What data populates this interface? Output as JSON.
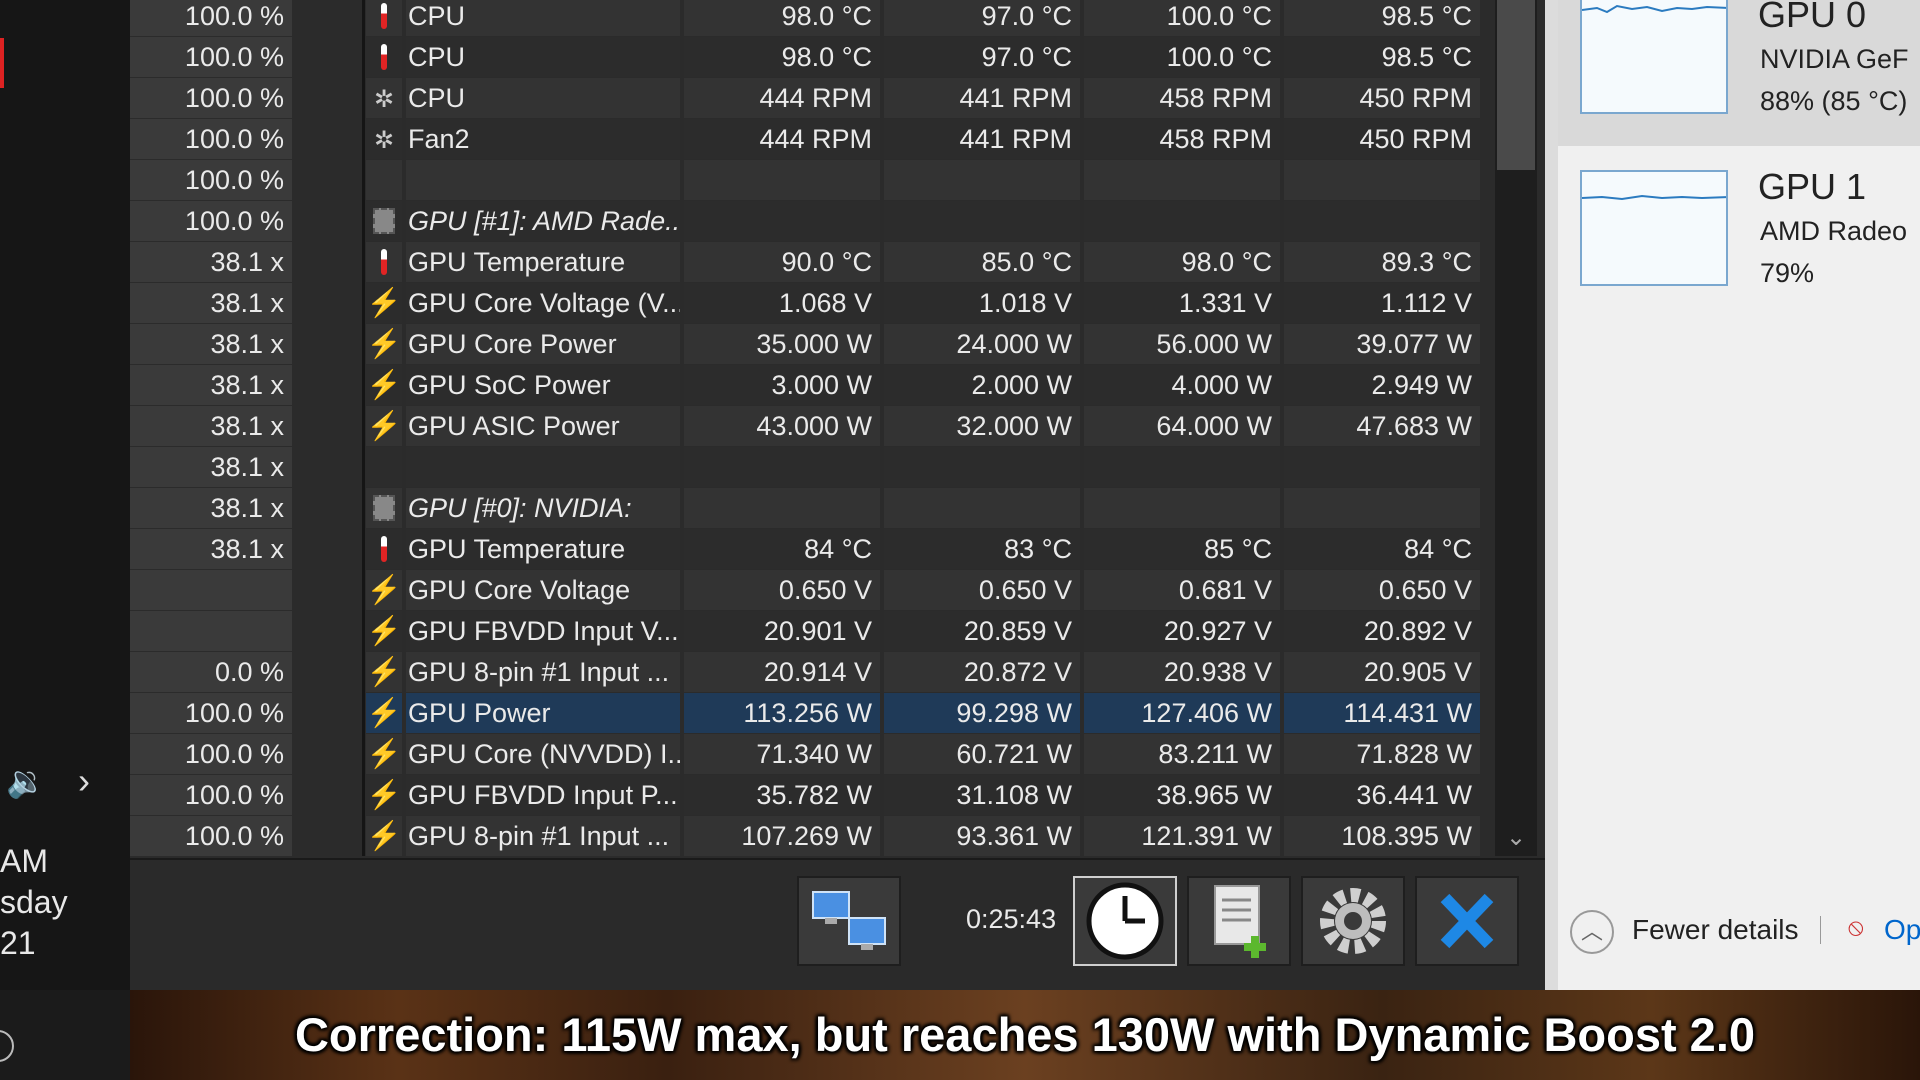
{
  "left_panel": {
    "time_suffix": "AM",
    "day_suffix": "sday",
    "year_suffix": "21"
  },
  "sensor_rows": [
    {
      "left": "100.0 %",
      "icon": "thermometer-icon",
      "name": "CPU",
      "v1": "98.0 °C",
      "v2": "97.0 °C",
      "v3": "100.0 °C",
      "v4": "98.5 °C",
      "italic": false,
      "selected": false
    },
    {
      "left": "100.0 %",
      "icon": "thermometer-icon",
      "name": "CPU",
      "v1": "98.0 °C",
      "v2": "97.0 °C",
      "v3": "100.0 °C",
      "v4": "98.5 °C",
      "italic": false,
      "selected": false
    },
    {
      "left": "100.0 %",
      "icon": "fan-icon",
      "name": "CPU",
      "v1": "444 RPM",
      "v2": "441 RPM",
      "v3": "458 RPM",
      "v4": "450 RPM",
      "italic": false,
      "selected": false
    },
    {
      "left": "100.0 %",
      "icon": "fan-icon",
      "name": "Fan2",
      "v1": "444 RPM",
      "v2": "441 RPM",
      "v3": "458 RPM",
      "v4": "450 RPM",
      "italic": false,
      "selected": false
    },
    {
      "left": "100.0 %",
      "icon": "",
      "name": "",
      "v1": "",
      "v2": "",
      "v3": "",
      "v4": "",
      "italic": false,
      "selected": false
    },
    {
      "left": "100.0 %",
      "icon": "chip-icon",
      "name": "GPU [#1]: AMD Rade...",
      "v1": "",
      "v2": "",
      "v3": "",
      "v4": "",
      "italic": true,
      "selected": false
    },
    {
      "left": "38.1 x",
      "icon": "thermometer-icon",
      "name": "GPU Temperature",
      "v1": "90.0 °C",
      "v2": "85.0 °C",
      "v3": "98.0 °C",
      "v4": "89.3 °C",
      "italic": false,
      "selected": false
    },
    {
      "left": "38.1 x",
      "icon": "bolt-icon",
      "name": "GPU Core Voltage (V...",
      "v1": "1.068 V",
      "v2": "1.018 V",
      "v3": "1.331 V",
      "v4": "1.112 V",
      "italic": false,
      "selected": false
    },
    {
      "left": "38.1 x",
      "icon": "bolt-icon",
      "name": "GPU Core Power",
      "v1": "35.000 W",
      "v2": "24.000 W",
      "v3": "56.000 W",
      "v4": "39.077 W",
      "italic": false,
      "selected": false
    },
    {
      "left": "38.1 x",
      "icon": "bolt-icon",
      "name": "GPU SoC Power",
      "v1": "3.000 W",
      "v2": "2.000 W",
      "v3": "4.000 W",
      "v4": "2.949 W",
      "italic": false,
      "selected": false
    },
    {
      "left": "38.1 x",
      "icon": "bolt-icon",
      "name": "GPU ASIC Power",
      "v1": "43.000 W",
      "v2": "32.000 W",
      "v3": "64.000 W",
      "v4": "47.683 W",
      "italic": false,
      "selected": false
    },
    {
      "left": "38.1 x",
      "icon": "",
      "name": "",
      "v1": "",
      "v2": "",
      "v3": "",
      "v4": "",
      "italic": false,
      "selected": false
    },
    {
      "left": "38.1 x",
      "icon": "chip-icon",
      "name": "GPU [#0]: NVIDIA:",
      "v1": "",
      "v2": "",
      "v3": "",
      "v4": "",
      "italic": true,
      "selected": false
    },
    {
      "left": "38.1 x",
      "icon": "thermometer-icon",
      "name": "GPU Temperature",
      "v1": "84 °C",
      "v2": "83 °C",
      "v3": "85 °C",
      "v4": "84 °C",
      "italic": false,
      "selected": false
    },
    {
      "left": "",
      "icon": "bolt-icon",
      "name": "GPU Core Voltage",
      "v1": "0.650 V",
      "v2": "0.650 V",
      "v3": "0.681 V",
      "v4": "0.650 V",
      "italic": false,
      "selected": false
    },
    {
      "left": "",
      "icon": "bolt-icon",
      "name": "GPU FBVDD Input V...",
      "v1": "20.901 V",
      "v2": "20.859 V",
      "v3": "20.927 V",
      "v4": "20.892 V",
      "italic": false,
      "selected": false
    },
    {
      "left": "0.0 %",
      "icon": "bolt-icon",
      "name": "GPU 8-pin #1 Input ...",
      "v1": "20.914 V",
      "v2": "20.872 V",
      "v3": "20.938 V",
      "v4": "20.905 V",
      "italic": false,
      "selected": false
    },
    {
      "left": "100.0 %",
      "icon": "bolt-icon",
      "name": "GPU Power",
      "v1": "113.256 W",
      "v2": "99.298 W",
      "v3": "127.406 W",
      "v4": "114.431 W",
      "italic": false,
      "selected": true
    },
    {
      "left": "100.0 %",
      "icon": "bolt-icon",
      "name": "GPU Core (NVVDD) I...",
      "v1": "71.340 W",
      "v2": "60.721 W",
      "v3": "83.211 W",
      "v4": "71.828 W",
      "italic": false,
      "selected": false
    },
    {
      "left": "100.0 %",
      "icon": "bolt-icon",
      "name": "GPU FBVDD Input P...",
      "v1": "35.782 W",
      "v2": "31.108 W",
      "v3": "38.965 W",
      "v4": "36.441 W",
      "italic": false,
      "selected": false
    },
    {
      "left": "100.0 %",
      "icon": "bolt-icon",
      "name": "GPU 8-pin #1 Input ...",
      "v1": "107.269 W",
      "v2": "93.361 W",
      "v3": "121.391 W",
      "v4": "108.395 W",
      "italic": false,
      "selected": false
    }
  ],
  "toolbar": {
    "timer": "0:25:43",
    "buttons": [
      "network-icon",
      "clock-icon",
      "report-add-icon",
      "settings-gear-icon",
      "close-x-icon"
    ]
  },
  "task_manager": {
    "gpus": [
      {
        "title": "GPU 0",
        "subtitle": "NVIDIA GeF",
        "usage": "88% (85 °C)",
        "selected": true
      },
      {
        "title": "GPU 1",
        "subtitle": "AMD Radeo",
        "usage": "79%",
        "selected": false
      }
    ],
    "fewer_details": "Fewer details",
    "open_link": "Op"
  },
  "caption": "Correction: 115W max, but reaches 130W with Dynamic Boost 2.0",
  "colors": {
    "selected_row": "#1f3a58",
    "bolt": "#f5a623",
    "thermometer": "#e02424",
    "close_x": "#1e88e5"
  }
}
